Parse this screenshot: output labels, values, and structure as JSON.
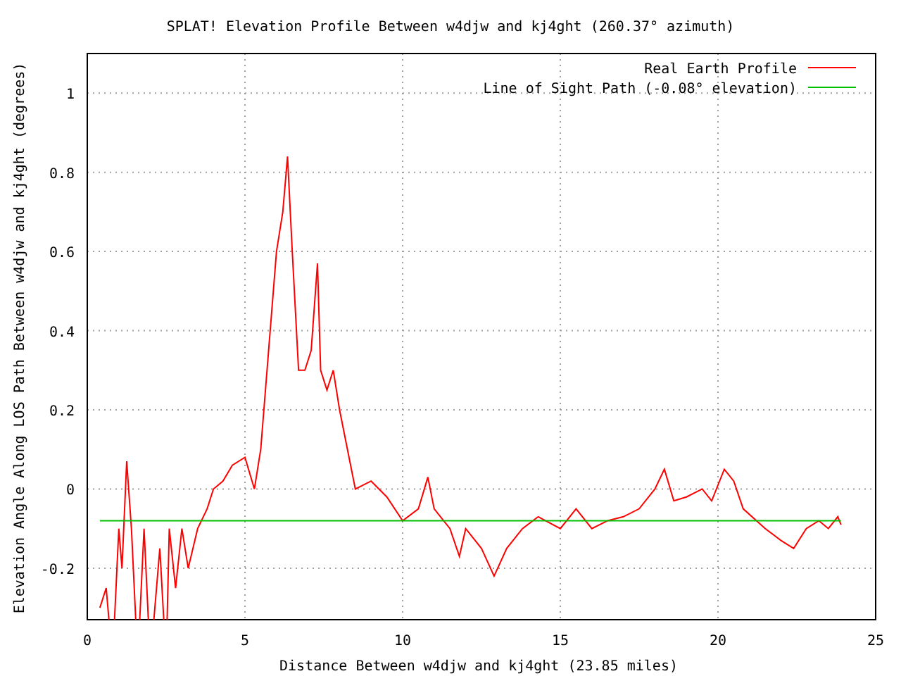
{
  "chart": {
    "chart_data": {
      "type": "line",
      "title": "SPLAT! Elevation Profile Between w4djw and kj4ght (260.37° azimuth)",
      "xlabel": "Distance Between w4djw and kj4ght (23.85 miles)",
      "ylabel": "Elevation Angle Along LOS Path Between w4djw and kj4ght (degrees)",
      "grid": true,
      "legend": true,
      "xlim": [
        0,
        25
      ],
      "ylim": [
        -0.33,
        1.1
      ],
      "xticks": [
        0,
        5,
        10,
        15,
        20,
        25
      ],
      "yticks": [
        {
          "value": -0.2,
          "label": "-0.2"
        },
        {
          "value": 0,
          "label": "0"
        },
        {
          "value": 0.2,
          "label": "0.2"
        },
        {
          "value": 0.4,
          "label": "0.4"
        },
        {
          "value": 0.6,
          "label": "0.6"
        },
        {
          "value": 0.8,
          "label": "0.8"
        },
        {
          "value": 1,
          "label": "1"
        }
      ],
      "x": [
        0.4,
        0.6,
        0.8,
        1.0,
        1.1,
        1.25,
        1.4,
        1.6,
        1.8,
        2.0,
        2.3,
        2.5,
        2.6,
        2.8,
        3.0,
        3.2,
        3.5,
        3.8,
        4.0,
        4.3,
        4.6,
        5.0,
        5.3,
        5.5,
        5.7,
        6.0,
        6.2,
        6.35,
        6.5,
        6.7,
        6.9,
        7.1,
        7.3,
        7.4,
        7.6,
        7.8,
        8.0,
        8.3,
        8.5,
        9.0,
        9.5,
        10.0,
        10.5,
        10.8,
        11.0,
        11.5,
        11.8,
        12.0,
        12.5,
        12.9,
        13.3,
        13.8,
        14.3,
        15.0,
        15.5,
        16.0,
        16.5,
        17.0,
        17.5,
        18.0,
        18.3,
        18.6,
        19.0,
        19.5,
        19.8,
        20.2,
        20.5,
        20.8,
        21.5,
        22.0,
        22.4,
        22.8,
        23.2,
        23.5,
        23.8,
        23.9
      ],
      "series": [
        {
          "name": "Real Earth Profile",
          "color": "#ff0000",
          "values": [
            -0.3,
            -0.25,
            null,
            -0.1,
            -0.2,
            0.07,
            -0.1,
            null,
            -0.1,
            null,
            -0.15,
            null,
            -0.1,
            -0.25,
            -0.1,
            -0.2,
            -0.1,
            -0.05,
            0.0,
            0.02,
            0.06,
            0.08,
            0.0,
            0.1,
            0.3,
            0.6,
            0.7,
            0.84,
            0.6,
            0.3,
            0.3,
            0.35,
            0.57,
            0.3,
            0.25,
            0.3,
            0.2,
            0.08,
            0.0,
            0.02,
            -0.02,
            -0.08,
            -0.05,
            0.03,
            -0.05,
            -0.1,
            -0.17,
            -0.1,
            -0.15,
            -0.22,
            -0.15,
            -0.1,
            -0.07,
            -0.1,
            -0.05,
            -0.1,
            -0.08,
            -0.07,
            -0.05,
            0.0,
            0.05,
            -0.03,
            -0.02,
            0.0,
            -0.03,
            0.05,
            0.02,
            -0.05,
            -0.1,
            -0.13,
            -0.15,
            -0.1,
            -0.08,
            -0.1,
            -0.07,
            -0.09
          ]
        },
        {
          "name": "Line of Sight Path (-0.08° elevation)",
          "color": "#00c000",
          "values": [
            -0.08,
            -0.08,
            -0.08,
            -0.08,
            -0.08,
            -0.08,
            -0.08,
            -0.08,
            -0.08,
            -0.08,
            -0.08,
            -0.08,
            -0.08,
            -0.08,
            -0.08,
            -0.08,
            -0.08,
            -0.08,
            -0.08,
            -0.08,
            -0.08,
            -0.08,
            -0.08,
            -0.08,
            -0.08,
            -0.08,
            -0.08,
            -0.08,
            -0.08,
            -0.08,
            -0.08,
            -0.08,
            -0.08,
            -0.08,
            -0.08,
            -0.08,
            -0.08,
            -0.08,
            -0.08,
            -0.08,
            -0.08,
            -0.08,
            -0.08,
            -0.08,
            -0.08,
            -0.08,
            -0.08,
            -0.08,
            -0.08,
            -0.08,
            -0.08,
            -0.08,
            -0.08,
            -0.08,
            -0.08,
            -0.08,
            -0.08,
            -0.08,
            -0.08,
            -0.08,
            -0.08,
            -0.08,
            -0.08,
            -0.08,
            -0.08,
            -0.08,
            -0.08,
            -0.08,
            -0.08,
            -0.08,
            -0.08,
            -0.08,
            -0.08,
            -0.08,
            -0.08,
            -0.08
          ]
        }
      ]
    }
  }
}
